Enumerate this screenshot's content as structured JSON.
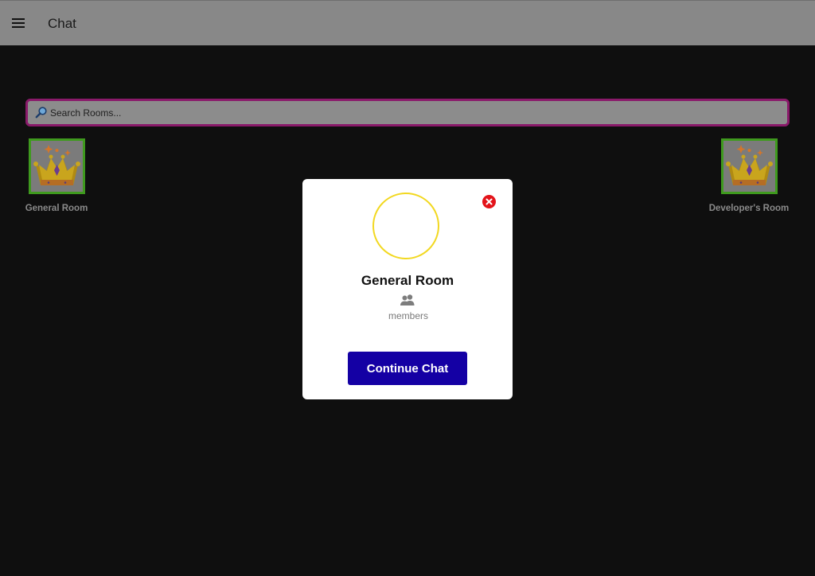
{
  "header": {
    "menu_icon": "hamburger-menu-icon",
    "title": "Chat",
    "background": "#888888"
  },
  "search": {
    "placeholder": "Search Rooms...",
    "value": "",
    "icon": "magnifier-icon",
    "border_color": "#8a1a6a"
  },
  "rooms": [
    {
      "name": "General Room",
      "icon": "crown-icon"
    },
    {
      "name": "Developer's Room",
      "icon": "crown-icon"
    }
  ],
  "modal": {
    "title": "General Room",
    "members_icon": "people-icon",
    "members_label": "members",
    "button_label": "Continue Chat",
    "button_color": "#1400a4",
    "close_icon": "close-icon",
    "close_color": "#e3141a",
    "avatar_ring_color": "#f2d820"
  }
}
